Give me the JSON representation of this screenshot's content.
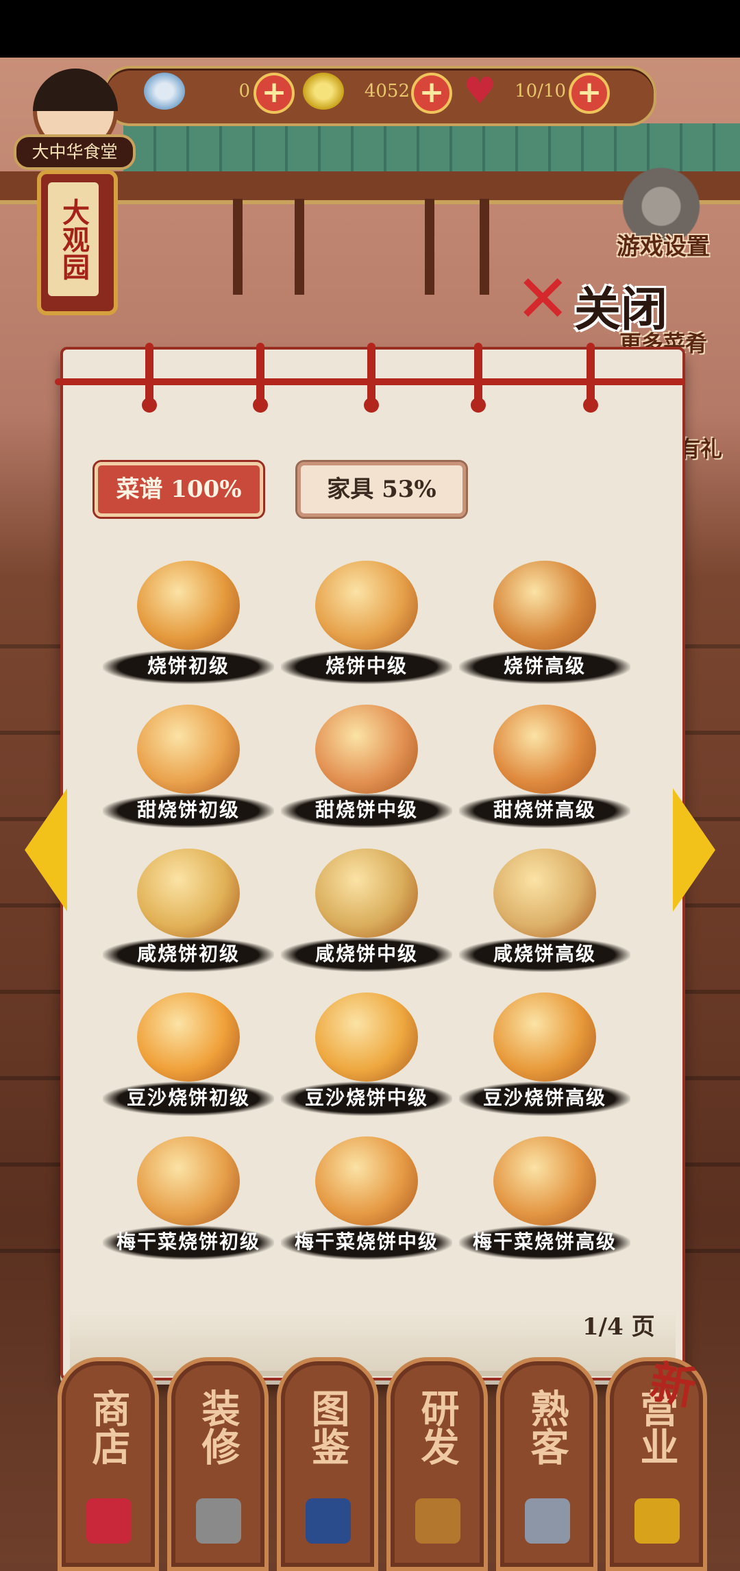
{
  "resources": {
    "silver": "0",
    "gold": "4052",
    "stamina": "10/10"
  },
  "restaurant_name": "大中华食堂",
  "sign_text": "大观园",
  "side_menu": {
    "settings": "游戏设置",
    "more": "更多菜肴",
    "gift": "有礼"
  },
  "close_label": "关闭",
  "tabs": [
    {
      "label": "菜谱  100%",
      "active": true
    },
    {
      "label": "家具  53%",
      "active": false
    }
  ],
  "items": [
    {
      "label": "烧饼初级",
      "icon": "flatbread-icon",
      "color": "#e59a3d"
    },
    {
      "label": "烧饼中级",
      "icon": "flatbread-wrapped-icon",
      "color": "#e6a14a"
    },
    {
      "label": "烧饼高级",
      "icon": "flatbread-deluxe-icon",
      "color": "#d7873a"
    },
    {
      "label": "甜烧饼初级",
      "icon": "sweet-flatbread-icon",
      "color": "#eaa24c"
    },
    {
      "label": "甜烧饼中级",
      "icon": "sweet-flatbread-pink-icon",
      "color": "#e29152"
    },
    {
      "label": "甜烧饼高级",
      "icon": "sweet-flatbread-red-icon",
      "color": "#df8a3e"
    },
    {
      "label": "咸烧饼初级",
      "icon": "salty-flatbread-icon",
      "color": "#e1b257"
    },
    {
      "label": "咸烧饼中级",
      "icon": "salty-flatbread-leaf-icon",
      "color": "#d9ad5b"
    },
    {
      "label": "咸烧饼高级",
      "icon": "salty-flatbread-wave-icon",
      "color": "#dcb068"
    },
    {
      "label": "豆沙烧饼初级",
      "icon": "bean-paste-flatbread-icon",
      "color": "#f0a13a"
    },
    {
      "label": "豆沙烧饼中级",
      "icon": "bean-paste-flatbread-ribbon-icon",
      "color": "#eea83f"
    },
    {
      "label": "豆沙烧饼高级",
      "icon": "bean-paste-flatbread-box-icon",
      "color": "#e89a3a"
    },
    {
      "label": "梅干菜烧饼初级",
      "icon": "preserved-veg-flatbread-icon",
      "color": "#e7a04a"
    },
    {
      "label": "梅干菜烧饼中级",
      "icon": "preserved-veg-flatbread-leaf-icon",
      "color": "#e69a44"
    },
    {
      "label": "梅干菜烧饼高级",
      "icon": "preserved-veg-flatbread-plate-icon",
      "color": "#e39643"
    }
  ],
  "page_indicator": "1/4 页",
  "nav": [
    "商店",
    "装修",
    "图鉴",
    "研发",
    "熟客",
    "营业"
  ],
  "new_badge": "新",
  "colors": {
    "accent_red": "#b3261e",
    "paper": "#ede6d8",
    "arrow": "#f3c21a"
  }
}
